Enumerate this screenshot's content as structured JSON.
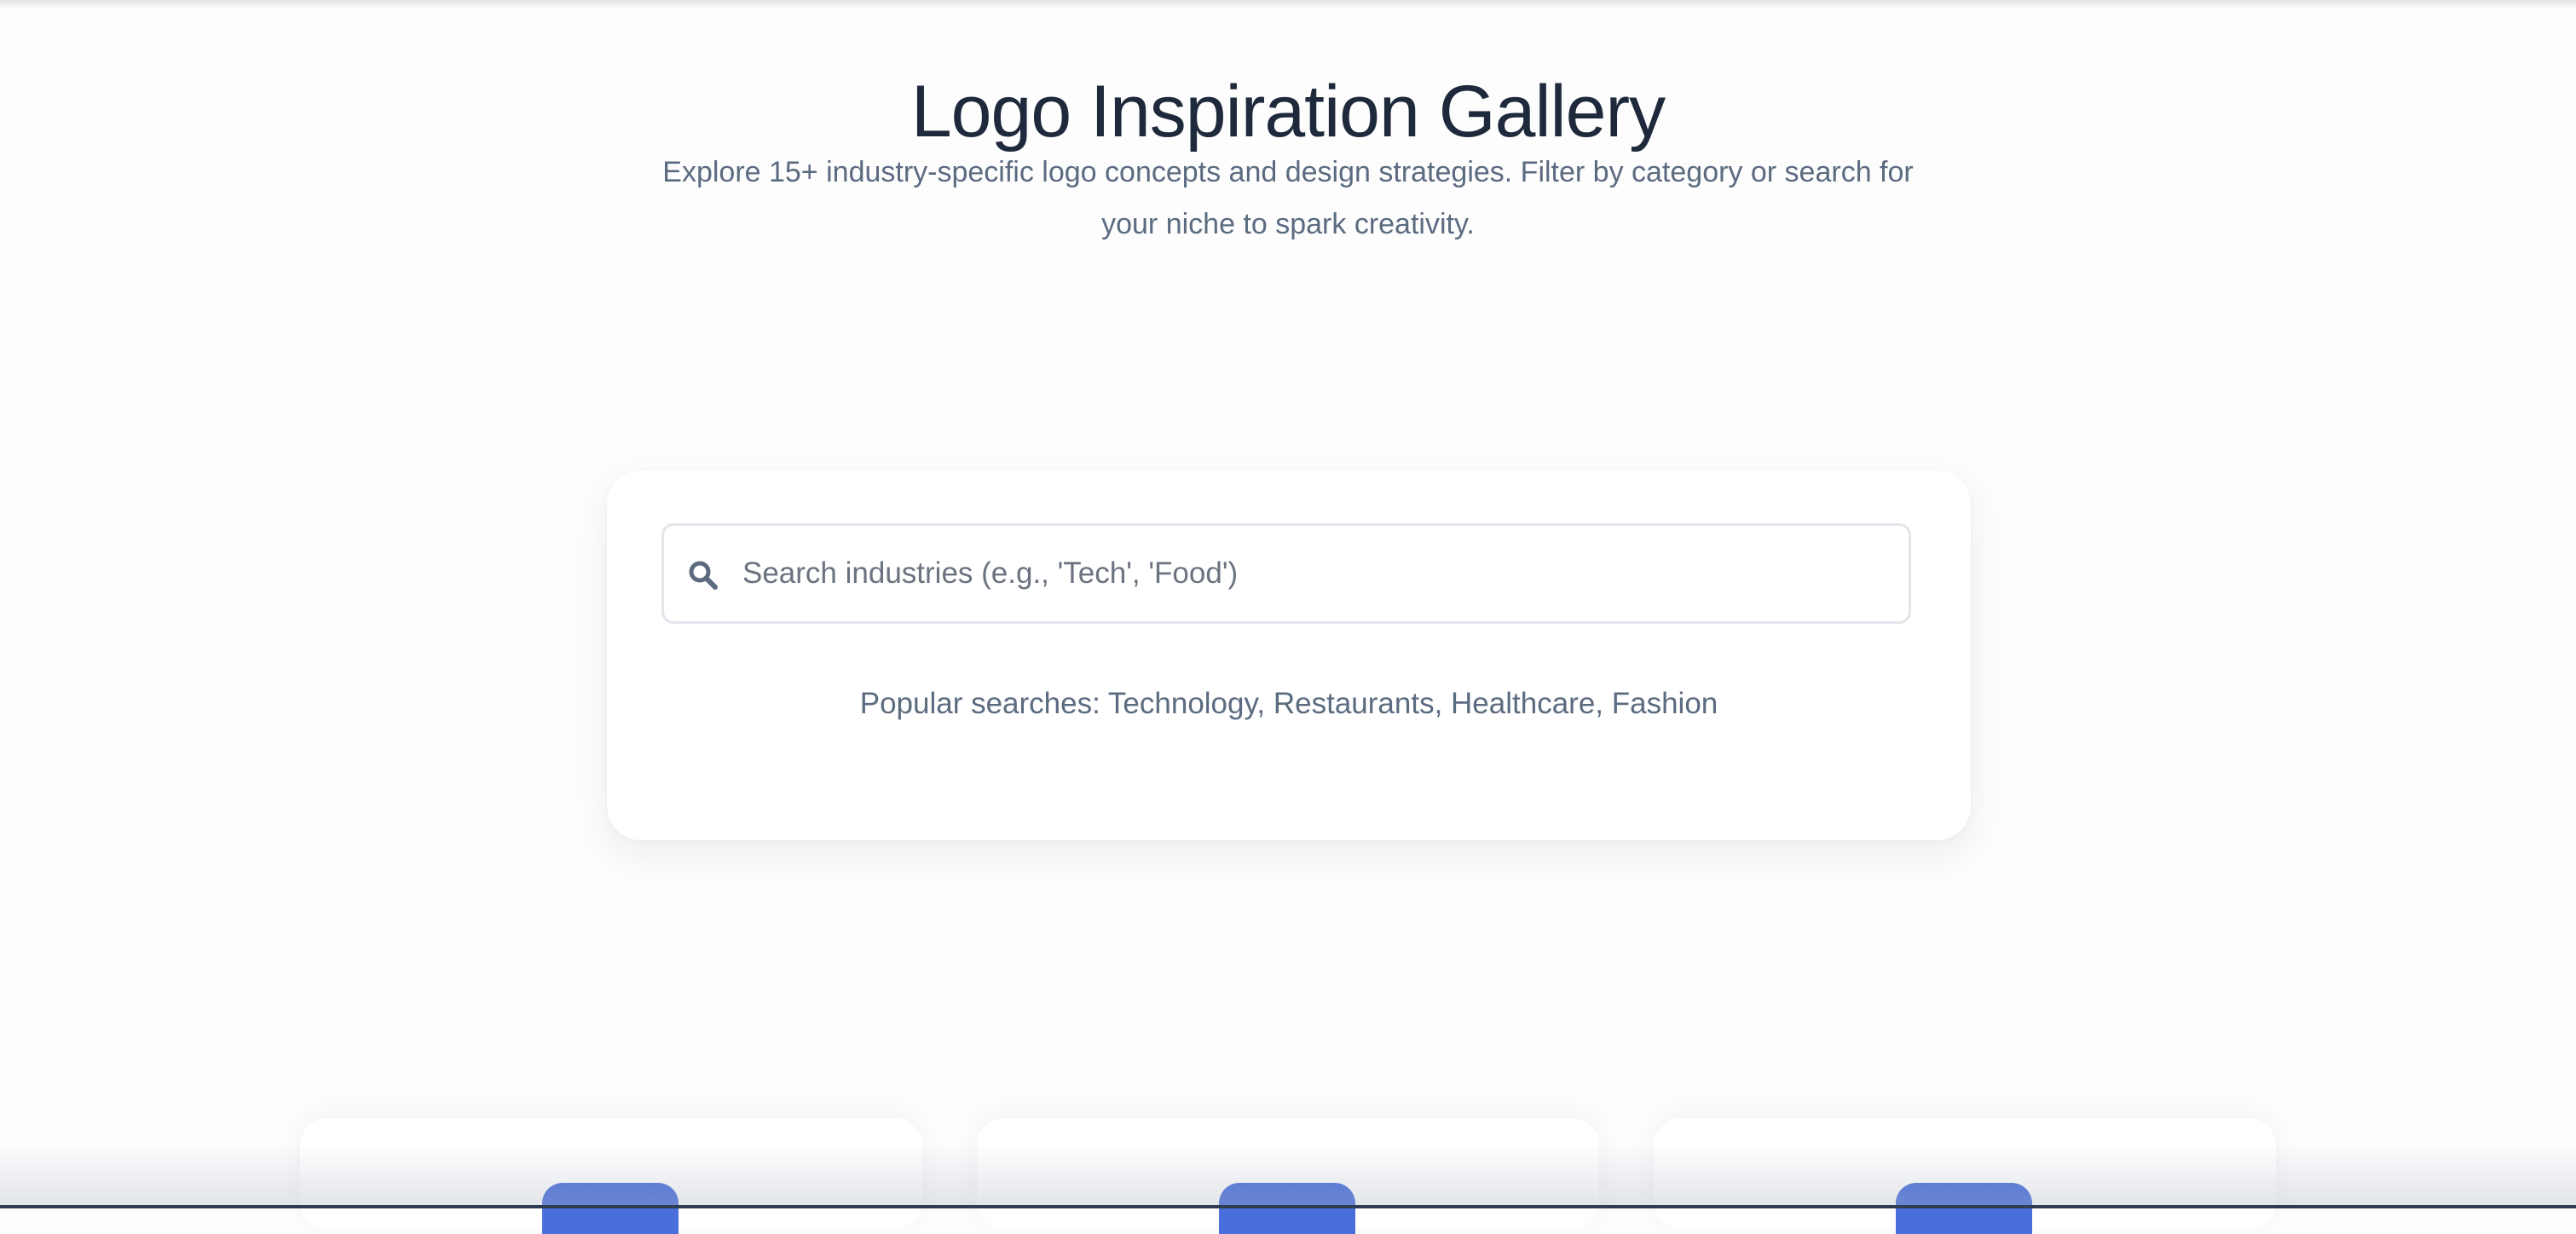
{
  "header": {
    "title": "Logo Inspiration Gallery",
    "subtitle_line1": "Explore 15+ industry-specific logo concepts and design strategies. Filter by category or search for",
    "subtitle_line2": "your niche to spark creativity."
  },
  "search": {
    "placeholder": "Search industries (e.g., 'Tech', 'Food')",
    "value": "",
    "icon": "search-icon"
  },
  "popular": {
    "label": "Popular searches:",
    "terms": [
      "Technology",
      "Restaurants",
      "Healthcare",
      "Fashion"
    ]
  },
  "colors": {
    "title": "#1e293b",
    "muted_text": "#5b6b80",
    "accent": "#4a6fdc",
    "card_background": "#ffffff",
    "page_background": "#fdfdfe"
  }
}
